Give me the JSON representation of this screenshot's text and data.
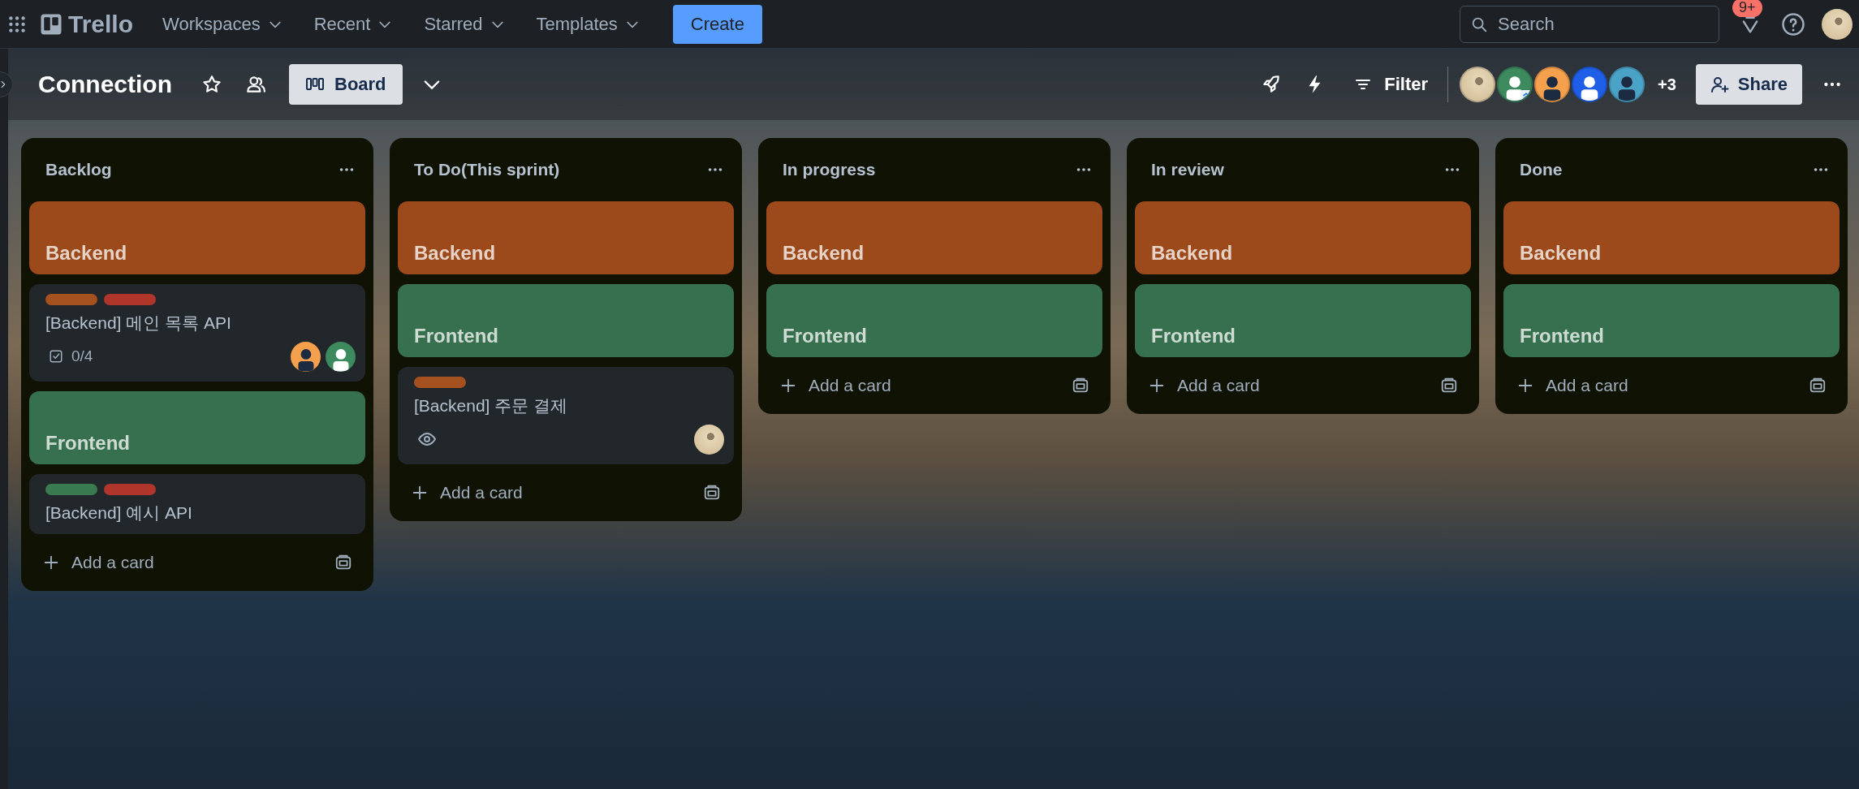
{
  "top_bar": {
    "logo": "Trello",
    "nav": [
      {
        "label": "Workspaces"
      },
      {
        "label": "Recent"
      },
      {
        "label": "Starred"
      },
      {
        "label": "Templates"
      }
    ],
    "create_button": "Create",
    "search": {
      "placeholder": "Search"
    },
    "notification_badge": "9+"
  },
  "board_header": {
    "title": "Connection",
    "starred": false,
    "view_button": "Board",
    "filter_button": "Filter",
    "members": [
      {
        "kind": "photo",
        "color": "#d8c6a4",
        "admin": false
      },
      {
        "kind": "person",
        "color": "#3c8a5e",
        "admin": true
      },
      {
        "kind": "person",
        "color": "#f5a04c",
        "admin": false
      },
      {
        "kind": "person",
        "color": "#1f5ee6",
        "admin": false
      },
      {
        "kind": "person",
        "color": "#4aa3c6",
        "admin": false
      }
    ],
    "members_more": "+3",
    "share_button": "Share"
  },
  "lists": [
    {
      "title": "Backlog",
      "add_card": "Add a card",
      "cards": [
        {
          "kind": "cover",
          "title": "Backend",
          "color": "#9c4a1b"
        },
        {
          "kind": "task",
          "labels": [
            {
              "color": "#a5501f"
            },
            {
              "color": "#b0352b"
            }
          ],
          "title": "[Backend] 메인 목록 API",
          "checklist": "0/4",
          "watching": false,
          "members": [
            {
              "kind": "person",
              "color": "#f5a04c"
            },
            {
              "kind": "person",
              "color": "#3c8a5e"
            }
          ]
        },
        {
          "kind": "cover",
          "title": "Frontend",
          "color": "#37704f"
        },
        {
          "kind": "task",
          "labels": [
            {
              "color": "#3a7a50"
            },
            {
              "color": "#b0352b"
            }
          ],
          "title": "[Backend] 예시 API"
        }
      ]
    },
    {
      "title": "To Do(This sprint)",
      "add_card": "Add a card",
      "cards": [
        {
          "kind": "cover",
          "title": "Backend",
          "color": "#9c4a1b"
        },
        {
          "kind": "cover",
          "title": "Frontend",
          "color": "#37704f"
        },
        {
          "kind": "task",
          "labels": [
            {
              "color": "#a5501f"
            }
          ],
          "title": "[Backend] 주문 결제",
          "watching": true,
          "members": [
            {
              "kind": "photo",
              "color": "#d8c6a4"
            }
          ]
        }
      ]
    },
    {
      "title": "In progress",
      "add_card": "Add a card",
      "cards": [
        {
          "kind": "cover",
          "title": "Backend",
          "color": "#9c4a1b"
        },
        {
          "kind": "cover",
          "title": "Frontend",
          "color": "#37704f"
        }
      ]
    },
    {
      "title": "In review",
      "add_card": "Add a card",
      "cards": [
        {
          "kind": "cover",
          "title": "Backend",
          "color": "#9c4a1b"
        },
        {
          "kind": "cover",
          "title": "Frontend",
          "color": "#37704f"
        }
      ]
    },
    {
      "title": "Done",
      "add_card": "Add a card",
      "cards": [
        {
          "kind": "cover",
          "title": "Backend",
          "color": "#9c4a1b"
        },
        {
          "kind": "cover",
          "title": "Frontend",
          "color": "#37704f"
        }
      ]
    }
  ]
}
